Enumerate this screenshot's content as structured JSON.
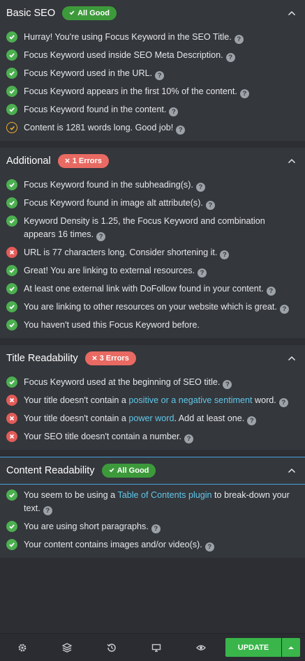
{
  "sections": [
    {
      "title": "Basic SEO",
      "badge": "All Good",
      "badge_kind": "good",
      "items": [
        {
          "status": "pass",
          "parts": [
            {
              "t": "Hurray! You're using Focus Keyword in the SEO Title."
            }
          ]
        },
        {
          "status": "pass",
          "parts": [
            {
              "t": "Focus Keyword used inside SEO Meta Description."
            }
          ]
        },
        {
          "status": "pass",
          "parts": [
            {
              "t": "Focus Keyword used in the URL."
            }
          ]
        },
        {
          "status": "pass",
          "parts": [
            {
              "t": "Focus Keyword appears in the first 10% of the content."
            }
          ]
        },
        {
          "status": "pass",
          "parts": [
            {
              "t": "Focus Keyword found in the content."
            }
          ]
        },
        {
          "status": "warn",
          "parts": [
            {
              "t": "Content is 1281 words long. Good job!"
            }
          ]
        }
      ]
    },
    {
      "title": "Additional",
      "badge": "1 Errors",
      "badge_kind": "err",
      "items": [
        {
          "status": "pass",
          "parts": [
            {
              "t": "Focus Keyword found in the subheading(s)."
            }
          ]
        },
        {
          "status": "pass",
          "parts": [
            {
              "t": "Focus Keyword found in image alt attribute(s)."
            }
          ]
        },
        {
          "status": "pass",
          "parts": [
            {
              "t": "Keyword Density is 1.25, the Focus Keyword and combination appears 16 times."
            }
          ]
        },
        {
          "status": "fail",
          "parts": [
            {
              "t": "URL is 77 characters long. Consider shortening it."
            }
          ]
        },
        {
          "status": "pass",
          "parts": [
            {
              "t": "Great! You are linking to external resources."
            }
          ]
        },
        {
          "status": "pass",
          "parts": [
            {
              "t": "At least one external link with DoFollow found in your content."
            }
          ]
        },
        {
          "status": "pass",
          "parts": [
            {
              "t": "You are linking to other resources on your website which is great."
            }
          ]
        },
        {
          "status": "pass",
          "parts": [
            {
              "t": "You haven't used this Focus Keyword before."
            }
          ],
          "no_help": true
        }
      ]
    },
    {
      "title": "Title Readability",
      "badge": "3 Errors",
      "badge_kind": "err",
      "items": [
        {
          "status": "pass",
          "parts": [
            {
              "t": "Focus Keyword used at the beginning of SEO title."
            }
          ]
        },
        {
          "status": "fail",
          "parts": [
            {
              "t": "Your title doesn't contain a "
            },
            {
              "t": "positive or a negative sentiment",
              "link": true
            },
            {
              "t": " word."
            }
          ]
        },
        {
          "status": "fail",
          "parts": [
            {
              "t": "Your title doesn't contain a "
            },
            {
              "t": "power word",
              "link": true
            },
            {
              "t": ". Add at least one."
            }
          ]
        },
        {
          "status": "fail",
          "parts": [
            {
              "t": "Your SEO title doesn't contain a number."
            }
          ]
        }
      ]
    },
    {
      "title": "Content Readability",
      "badge": "All Good",
      "badge_kind": "good",
      "active": true,
      "items": [
        {
          "status": "pass",
          "parts": [
            {
              "t": "You seem to be using a "
            },
            {
              "t": "Table of Contents plugin",
              "link": true
            },
            {
              "t": " to break-down your text."
            }
          ]
        },
        {
          "status": "pass",
          "parts": [
            {
              "t": "You are using short paragraphs."
            }
          ]
        },
        {
          "status": "pass",
          "parts": [
            {
              "t": "Your content contains images and/or video(s)."
            }
          ]
        }
      ]
    }
  ],
  "help_glyph": "?",
  "footer": {
    "buttons": [
      "settings-icon",
      "navigator-layers-icon",
      "history-icon",
      "responsive-desktop-icon",
      "preview-eye-icon"
    ],
    "update_label": "UPDATE"
  },
  "colors": {
    "pass": "#4caf50",
    "fail": "#e25c59",
    "warn": "#f0ad30",
    "link": "#61c7e9",
    "update": "#39b54a"
  }
}
